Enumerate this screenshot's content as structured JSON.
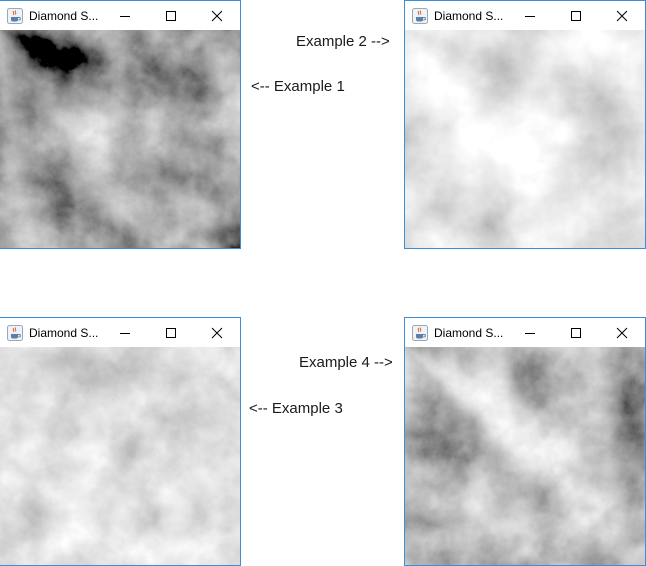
{
  "windows": [
    {
      "title": "Diamond S...",
      "variant": "ex1"
    },
    {
      "title": "Diamond S...",
      "variant": "ex2"
    },
    {
      "title": "Diamond S...",
      "variant": "ex3"
    },
    {
      "title": "Diamond S...",
      "variant": "ex4"
    }
  ],
  "captions": {
    "example1": "<-- Example 1",
    "example2": "Example 2 -->",
    "example3": "<-- Example 3",
    "example4": "Example 4 -->"
  },
  "icons": {
    "app": "java-coffee-cup-icon",
    "minimize": "minimize-icon",
    "maximize": "maximize-icon",
    "close": "close-icon"
  },
  "colors": {
    "window_border": "#3c8fd6"
  }
}
